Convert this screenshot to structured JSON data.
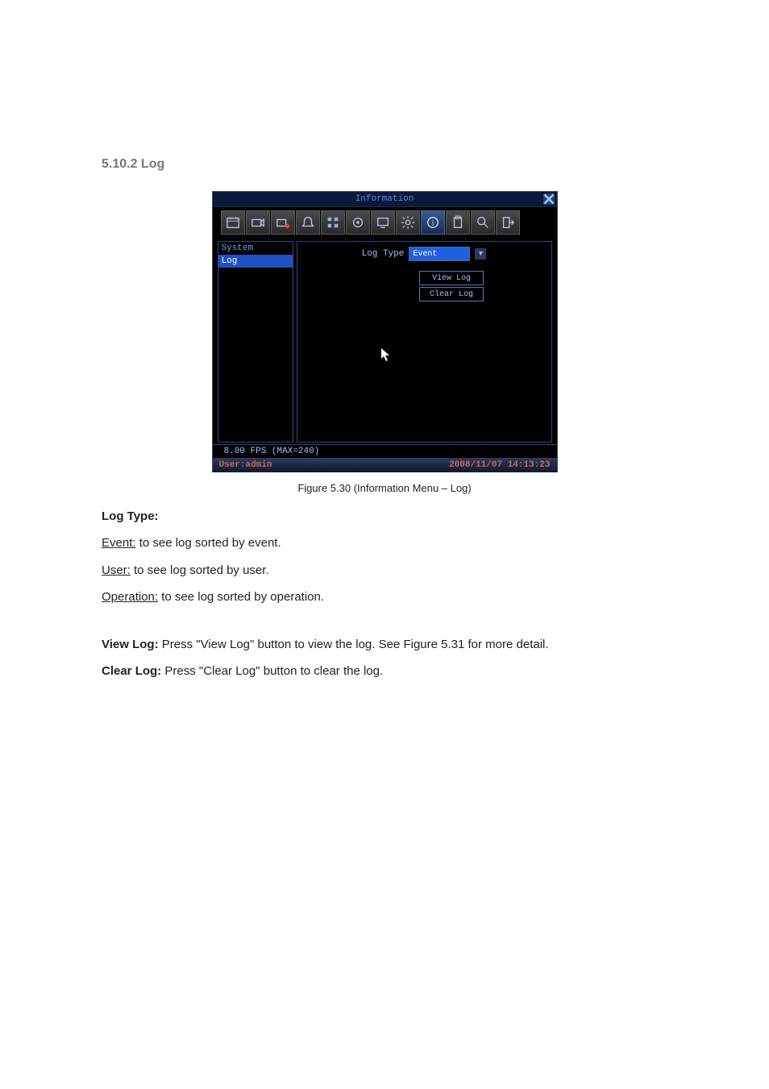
{
  "section_title": "5.10.2 Log",
  "screenshot": {
    "titlebar": {
      "title": "Information"
    },
    "toolbar_icons": [
      "calendar-icon",
      "camera-icon",
      "record-dot-icon",
      "alarm-bell-icon",
      "motion-grid-icon",
      "circle-mask-icon",
      "monitor-icon",
      "gear-icon",
      "info-icon",
      "clipboard-icon",
      "search-icon",
      "exit-icon"
    ],
    "sidebar": {
      "items": [
        {
          "label": "System",
          "selected": false
        },
        {
          "label": "Log",
          "selected": true
        }
      ]
    },
    "detail": {
      "log_type_label": "Log Type",
      "log_type_value": "Event",
      "buttons": {
        "view_log": "View Log",
        "clear_log": "Clear Log"
      }
    },
    "footer": {
      "fps": "8.00 FPS (MAX=240)",
      "user_label": "User:admin",
      "datetime": "2008/11/07  14:13:23"
    }
  },
  "figure_caption": "Figure 5.30 (Information Menu – Log)",
  "body": {
    "log_type_heading": "Log Type:",
    "items": [
      {
        "name": "Event:",
        "desc": " to see log sorted by event."
      },
      {
        "name": "User:",
        "desc": " to see log sorted by user."
      },
      {
        "name": "Operation:",
        "desc": " to see log sorted by operation."
      }
    ],
    "view_log_label": "View Log:",
    "view_log_desc": " Press \"View Log\" button to view the log. See Figure 5.31 for more detail.",
    "clear_log_label": "Clear Log:",
    "clear_log_desc": " Press \"Clear Log\" button to clear the log."
  }
}
